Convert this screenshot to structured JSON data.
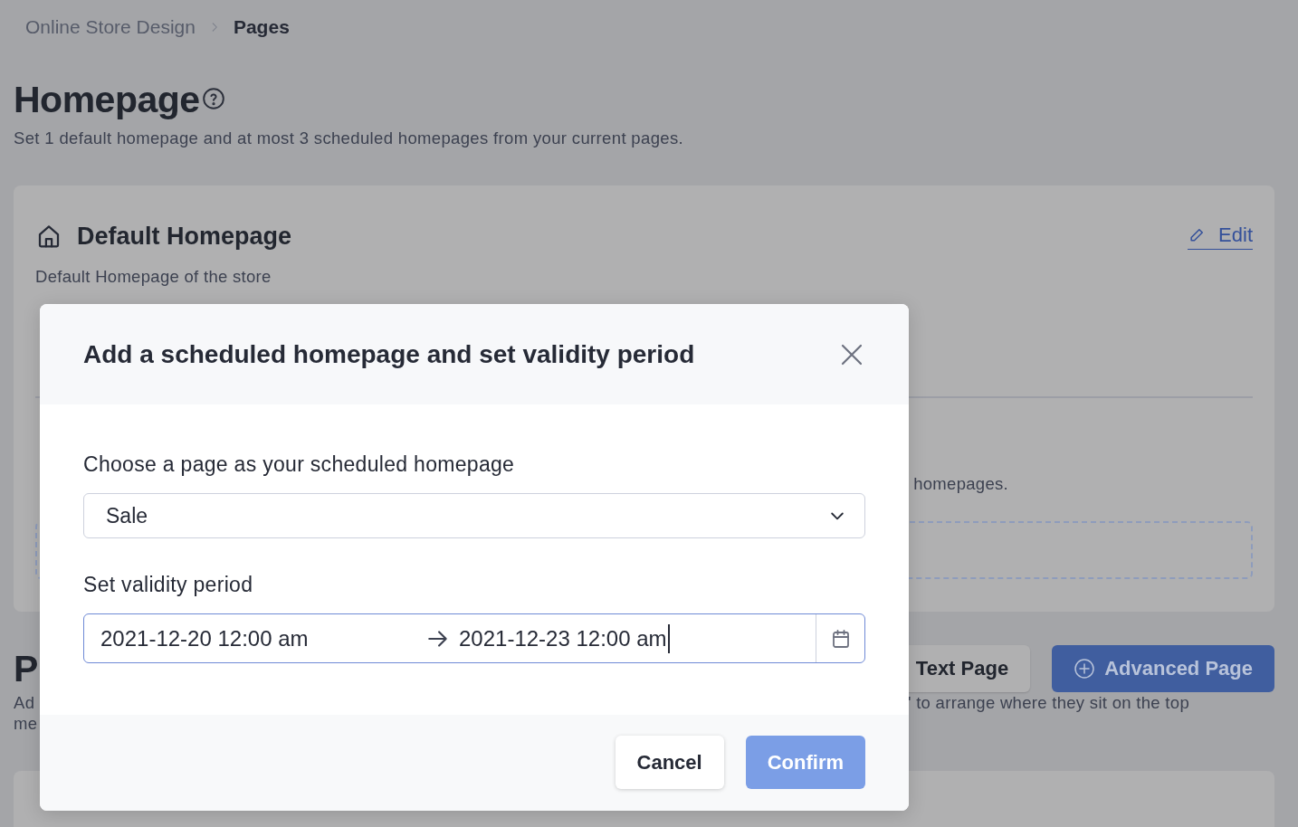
{
  "breadcrumb": [
    {
      "label": "Online Store Design",
      "current": false
    },
    {
      "label": "Pages",
      "current": true
    }
  ],
  "header": {
    "title": "Homepage",
    "subtitle": "Set 1 default homepage and at most 3 scheduled homepages from your current pages."
  },
  "default_card": {
    "title": "Default Homepage",
    "subtitle": "Default Homepage of the store",
    "edit_link": "Edit",
    "section_fragment_end": "homepages."
  },
  "pages_section": {
    "title_fragment": "P",
    "desc_fragments": [
      "Ad",
      "me"
    ],
    "desc_right": "' to arrange where they sit on the top",
    "buttons": [
      {
        "label": "Text Page",
        "kind": "secondary"
      },
      {
        "label": "Advanced Page",
        "kind": "primary"
      }
    ]
  },
  "modal": {
    "title": "Add a scheduled homepage and set validity period",
    "fields": [
      {
        "kind": "select",
        "label": "Choose a page as your scheduled homepage",
        "value": "Sale",
        "focused": false
      },
      {
        "kind": "daterange",
        "label": "Set validity period",
        "start": "2021-12-20 12:00 am",
        "end": "2021-12-23 12:00 am",
        "focused": true
      }
    ],
    "buttons": [
      {
        "label": "Cancel",
        "kind": "secondary"
      },
      {
        "label": "Confirm",
        "kind": "primary"
      }
    ]
  }
}
